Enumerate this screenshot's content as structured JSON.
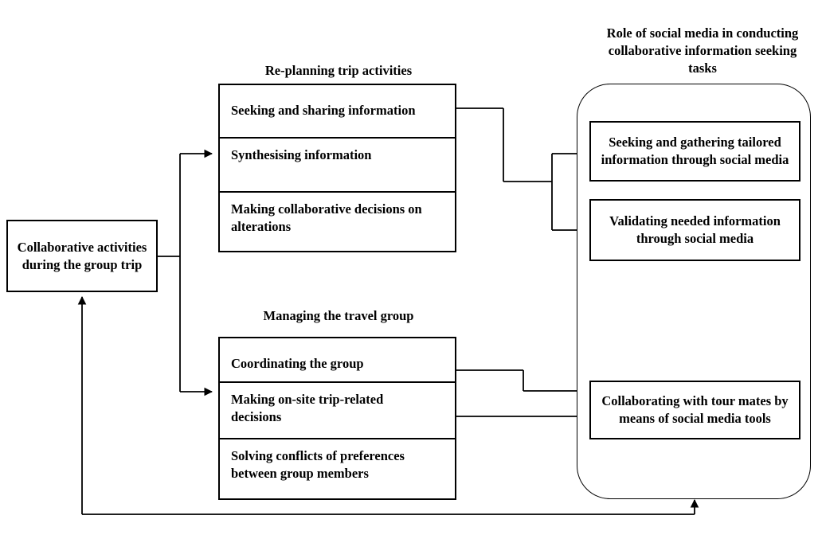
{
  "diagram": {
    "title_left": "Collaborative activities during the group trip",
    "heading_replanning": "Re-planning trip  activities",
    "heading_managing": "Managing the travel group",
    "heading_role": "Role of social media in conducting collaborative information seeking  tasks"
  },
  "left_box": {
    "label": "Collaborative activities during the group trip"
  },
  "replanning_group": {
    "heading": "Re-planning trip  activities",
    "items": [
      {
        "label": "Seeking and sharing information"
      },
      {
        "label": "Synthesising information"
      },
      {
        "label": "Making collaborative decisions on alterations"
      }
    ]
  },
  "managing_group": {
    "heading": "Managing the travel group",
    "items": [
      {
        "label": "Coordinating the group"
      },
      {
        "label": "Making on-site trip-related decisions"
      },
      {
        "label": "Solving conflicts of preferences between group members"
      }
    ]
  },
  "social_media_group": {
    "heading": "Role of social media in conducting collaborative information seeking  tasks",
    "items": [
      {
        "label": "Seeking and gathering tailored information through social media"
      },
      {
        "label": "Validating needed information through social media"
      },
      {
        "label": "Collaborating with tour mates by means of social media tools"
      }
    ]
  },
  "colors": {
    "stroke": "#000000",
    "background": "#ffffff",
    "text": "#000000"
  }
}
